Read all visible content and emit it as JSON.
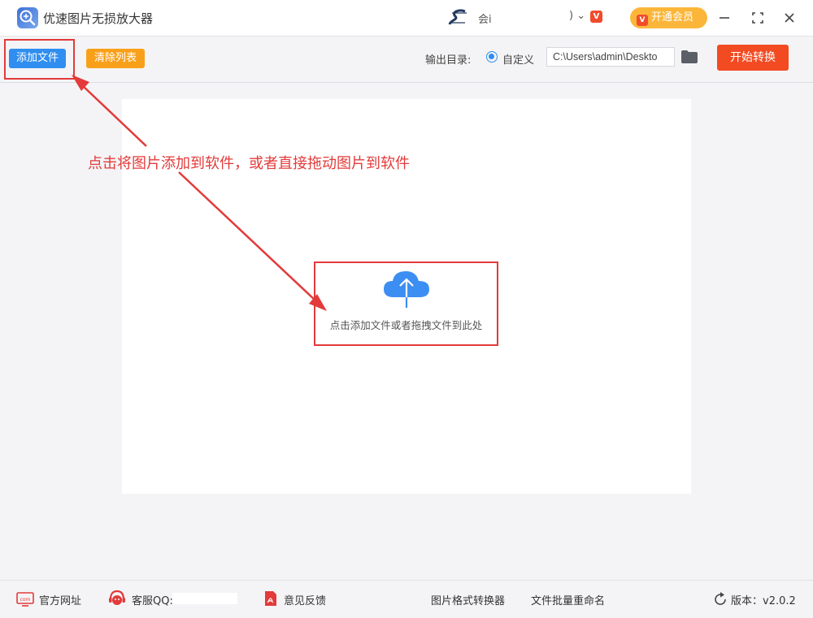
{
  "app": {
    "title": "优速图片无损放大器"
  },
  "user": {
    "name": "会i",
    "chevron": ") ⌄",
    "vip_badge": "V",
    "vip_button_label": "开通会员"
  },
  "toolbar": {
    "add_file_label": "添加文件",
    "clear_list_label": "清除列表",
    "output_dir_label": "输出目录:",
    "radio_custom_label": "自定义",
    "output_path_value": "C:\\Users\\admin\\Deskto",
    "start_label": "开始转换"
  },
  "main": {
    "hint_text": "点击将图片添加到软件，或者直接拖动图片到软件",
    "drop_text": "点击添加文件或者拖拽文件到此处"
  },
  "footer": {
    "official_site": "官方网址",
    "support_qq": "客服QQ:",
    "feedback": "意见反馈",
    "format_converter": "图片格式转换器",
    "batch_rename": "文件批量重命名",
    "version": "版本：v2.0.2"
  },
  "colors": {
    "primary_blue": "#2f8ef0",
    "clear_orange": "#f9a01b",
    "start_red": "#f24b22",
    "annotation_red": "#e33a3a",
    "vip_yellow": "#fbb63a"
  }
}
